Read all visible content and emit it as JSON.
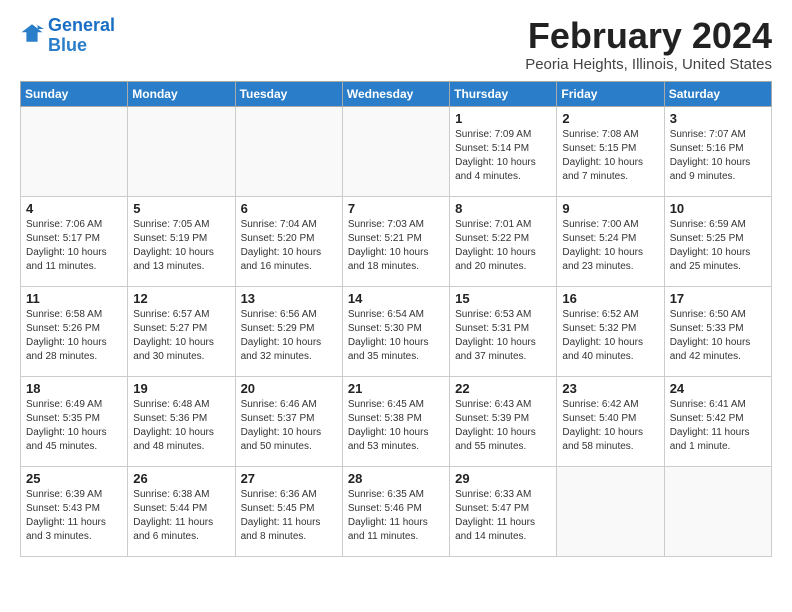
{
  "logo": {
    "line1": "General",
    "line2": "Blue"
  },
  "title": "February 2024",
  "location": "Peoria Heights, Illinois, United States",
  "days_of_week": [
    "Sunday",
    "Monday",
    "Tuesday",
    "Wednesday",
    "Thursday",
    "Friday",
    "Saturday"
  ],
  "weeks": [
    [
      {
        "num": "",
        "info": ""
      },
      {
        "num": "",
        "info": ""
      },
      {
        "num": "",
        "info": ""
      },
      {
        "num": "",
        "info": ""
      },
      {
        "num": "1",
        "info": "Sunrise: 7:09 AM\nSunset: 5:14 PM\nDaylight: 10 hours\nand 4 minutes."
      },
      {
        "num": "2",
        "info": "Sunrise: 7:08 AM\nSunset: 5:15 PM\nDaylight: 10 hours\nand 7 minutes."
      },
      {
        "num": "3",
        "info": "Sunrise: 7:07 AM\nSunset: 5:16 PM\nDaylight: 10 hours\nand 9 minutes."
      }
    ],
    [
      {
        "num": "4",
        "info": "Sunrise: 7:06 AM\nSunset: 5:17 PM\nDaylight: 10 hours\nand 11 minutes."
      },
      {
        "num": "5",
        "info": "Sunrise: 7:05 AM\nSunset: 5:19 PM\nDaylight: 10 hours\nand 13 minutes."
      },
      {
        "num": "6",
        "info": "Sunrise: 7:04 AM\nSunset: 5:20 PM\nDaylight: 10 hours\nand 16 minutes."
      },
      {
        "num": "7",
        "info": "Sunrise: 7:03 AM\nSunset: 5:21 PM\nDaylight: 10 hours\nand 18 minutes."
      },
      {
        "num": "8",
        "info": "Sunrise: 7:01 AM\nSunset: 5:22 PM\nDaylight: 10 hours\nand 20 minutes."
      },
      {
        "num": "9",
        "info": "Sunrise: 7:00 AM\nSunset: 5:24 PM\nDaylight: 10 hours\nand 23 minutes."
      },
      {
        "num": "10",
        "info": "Sunrise: 6:59 AM\nSunset: 5:25 PM\nDaylight: 10 hours\nand 25 minutes."
      }
    ],
    [
      {
        "num": "11",
        "info": "Sunrise: 6:58 AM\nSunset: 5:26 PM\nDaylight: 10 hours\nand 28 minutes."
      },
      {
        "num": "12",
        "info": "Sunrise: 6:57 AM\nSunset: 5:27 PM\nDaylight: 10 hours\nand 30 minutes."
      },
      {
        "num": "13",
        "info": "Sunrise: 6:56 AM\nSunset: 5:29 PM\nDaylight: 10 hours\nand 32 minutes."
      },
      {
        "num": "14",
        "info": "Sunrise: 6:54 AM\nSunset: 5:30 PM\nDaylight: 10 hours\nand 35 minutes."
      },
      {
        "num": "15",
        "info": "Sunrise: 6:53 AM\nSunset: 5:31 PM\nDaylight: 10 hours\nand 37 minutes."
      },
      {
        "num": "16",
        "info": "Sunrise: 6:52 AM\nSunset: 5:32 PM\nDaylight: 10 hours\nand 40 minutes."
      },
      {
        "num": "17",
        "info": "Sunrise: 6:50 AM\nSunset: 5:33 PM\nDaylight: 10 hours\nand 42 minutes."
      }
    ],
    [
      {
        "num": "18",
        "info": "Sunrise: 6:49 AM\nSunset: 5:35 PM\nDaylight: 10 hours\nand 45 minutes."
      },
      {
        "num": "19",
        "info": "Sunrise: 6:48 AM\nSunset: 5:36 PM\nDaylight: 10 hours\nand 48 minutes."
      },
      {
        "num": "20",
        "info": "Sunrise: 6:46 AM\nSunset: 5:37 PM\nDaylight: 10 hours\nand 50 minutes."
      },
      {
        "num": "21",
        "info": "Sunrise: 6:45 AM\nSunset: 5:38 PM\nDaylight: 10 hours\nand 53 minutes."
      },
      {
        "num": "22",
        "info": "Sunrise: 6:43 AM\nSunset: 5:39 PM\nDaylight: 10 hours\nand 55 minutes."
      },
      {
        "num": "23",
        "info": "Sunrise: 6:42 AM\nSunset: 5:40 PM\nDaylight: 10 hours\nand 58 minutes."
      },
      {
        "num": "24",
        "info": "Sunrise: 6:41 AM\nSunset: 5:42 PM\nDaylight: 11 hours\nand 1 minute."
      }
    ],
    [
      {
        "num": "25",
        "info": "Sunrise: 6:39 AM\nSunset: 5:43 PM\nDaylight: 11 hours\nand 3 minutes."
      },
      {
        "num": "26",
        "info": "Sunrise: 6:38 AM\nSunset: 5:44 PM\nDaylight: 11 hours\nand 6 minutes."
      },
      {
        "num": "27",
        "info": "Sunrise: 6:36 AM\nSunset: 5:45 PM\nDaylight: 11 hours\nand 8 minutes."
      },
      {
        "num": "28",
        "info": "Sunrise: 6:35 AM\nSunset: 5:46 PM\nDaylight: 11 hours\nand 11 minutes."
      },
      {
        "num": "29",
        "info": "Sunrise: 6:33 AM\nSunset: 5:47 PM\nDaylight: 11 hours\nand 14 minutes."
      },
      {
        "num": "",
        "info": ""
      },
      {
        "num": "",
        "info": ""
      }
    ]
  ]
}
